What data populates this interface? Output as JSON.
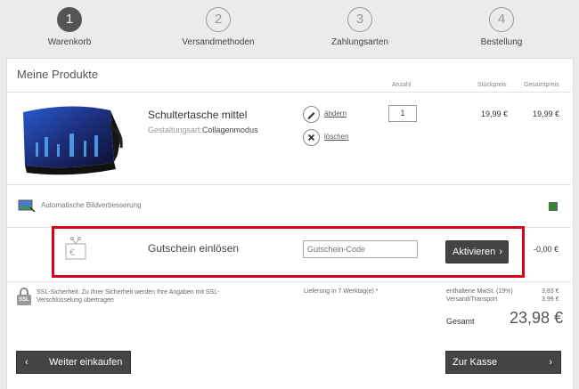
{
  "steps": [
    {
      "number": "1",
      "label": "Warenkorb"
    },
    {
      "number": "2",
      "label": "Versandmethoden"
    },
    {
      "number": "3",
      "label": "Zahlungsarten"
    },
    {
      "number": "4",
      "label": "Bestellung"
    }
  ],
  "products": {
    "title": "Meine Produkte",
    "col_quantity": "Anzahl",
    "col_unit_price": "Stückpreis",
    "col_total_price": "Gesamtpreis",
    "item": {
      "name": "Schultertasche mittel",
      "design_type_label": "Gestaltungsart:",
      "design_type_value": "Collagenmodus",
      "edit_link": "ändern",
      "delete_link": "löschen",
      "quantity": "1",
      "unit_price": "19,99 €",
      "total_price": "19,99 €"
    }
  },
  "image_enhance": {
    "label": "Automatische Bildverbesserung"
  },
  "voucher": {
    "title": "Gutschein einlösen",
    "placeholder": "Gutschein-Code",
    "button": "Aktivieren",
    "amount": "-0,00 €"
  },
  "summary": {
    "ssl_text_1": "SSL-Sicherheit: Zu Ihrer Sicherheit werden Ihre Angaben mit SSL-",
    "ssl_text_2": "Verschlüsselung übertragen",
    "ssl_badge": "SSL",
    "delivery": "Lieferung in 7 Werktag(e) *",
    "vat_label": "enthaltene MwSt. (19%)",
    "vat_value": "3,83 €",
    "shipping_label": "Versand/Transport",
    "shipping_value": "3,99 €",
    "total_label": "Gesamt",
    "total_value": "23,98 €"
  },
  "buttons": {
    "continue_shopping": "Weiter einkaufen",
    "checkout": "Zur Kasse"
  },
  "colors": {
    "highlight_border": "#d9001b",
    "button_dark": "#444444",
    "checkbox_green": "#2e8b2e"
  }
}
